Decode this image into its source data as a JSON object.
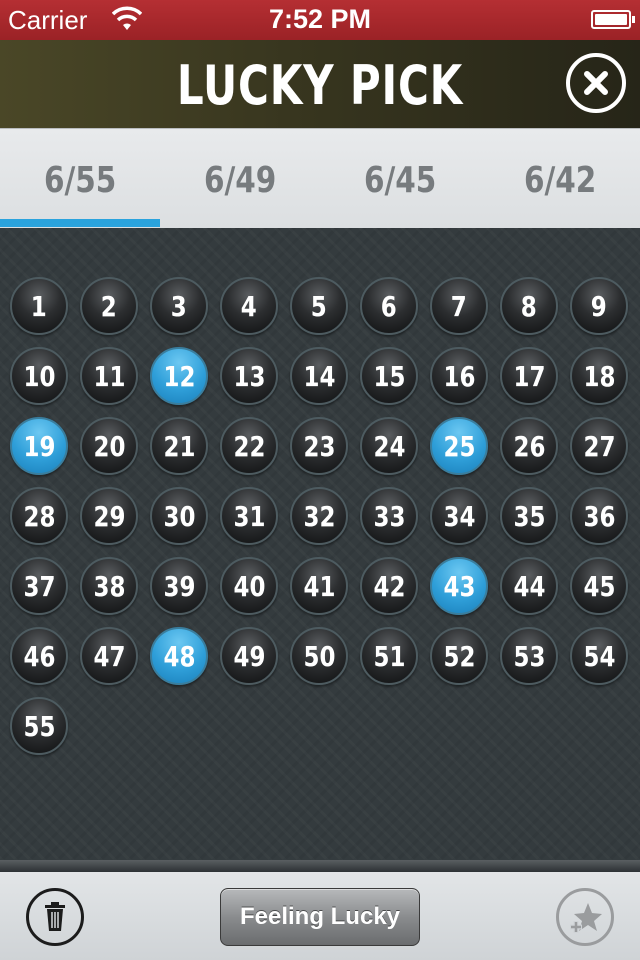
{
  "status": {
    "carrier": "Carrier",
    "time": "7:52 PM"
  },
  "nav": {
    "title": "LUCKY PICK"
  },
  "tabs": [
    "6/55",
    "6/49",
    "6/45",
    "6/42"
  ],
  "active_tab": "6/55",
  "numbers": {
    "values": [
      1,
      2,
      3,
      4,
      5,
      6,
      7,
      8,
      9,
      10,
      11,
      12,
      13,
      14,
      15,
      16,
      17,
      18,
      19,
      20,
      21,
      22,
      23,
      24,
      25,
      26,
      27,
      28,
      29,
      30,
      31,
      32,
      33,
      34,
      35,
      36,
      37,
      38,
      39,
      40,
      41,
      42,
      43,
      44,
      45,
      46,
      47,
      48,
      49,
      50,
      51,
      52,
      53,
      54,
      55
    ],
    "selected": [
      12,
      19,
      25,
      43,
      48
    ]
  },
  "toolbar": {
    "lucky_label": "Feeling Lucky"
  },
  "icons": {
    "wifi": "wifi-icon",
    "battery": "battery-icon",
    "close": "close-icon",
    "trash": "trash-icon",
    "favorite": "star-plus-icon"
  },
  "colors": {
    "accent": "#2aa3dd",
    "status_bar": "#9b2226"
  }
}
